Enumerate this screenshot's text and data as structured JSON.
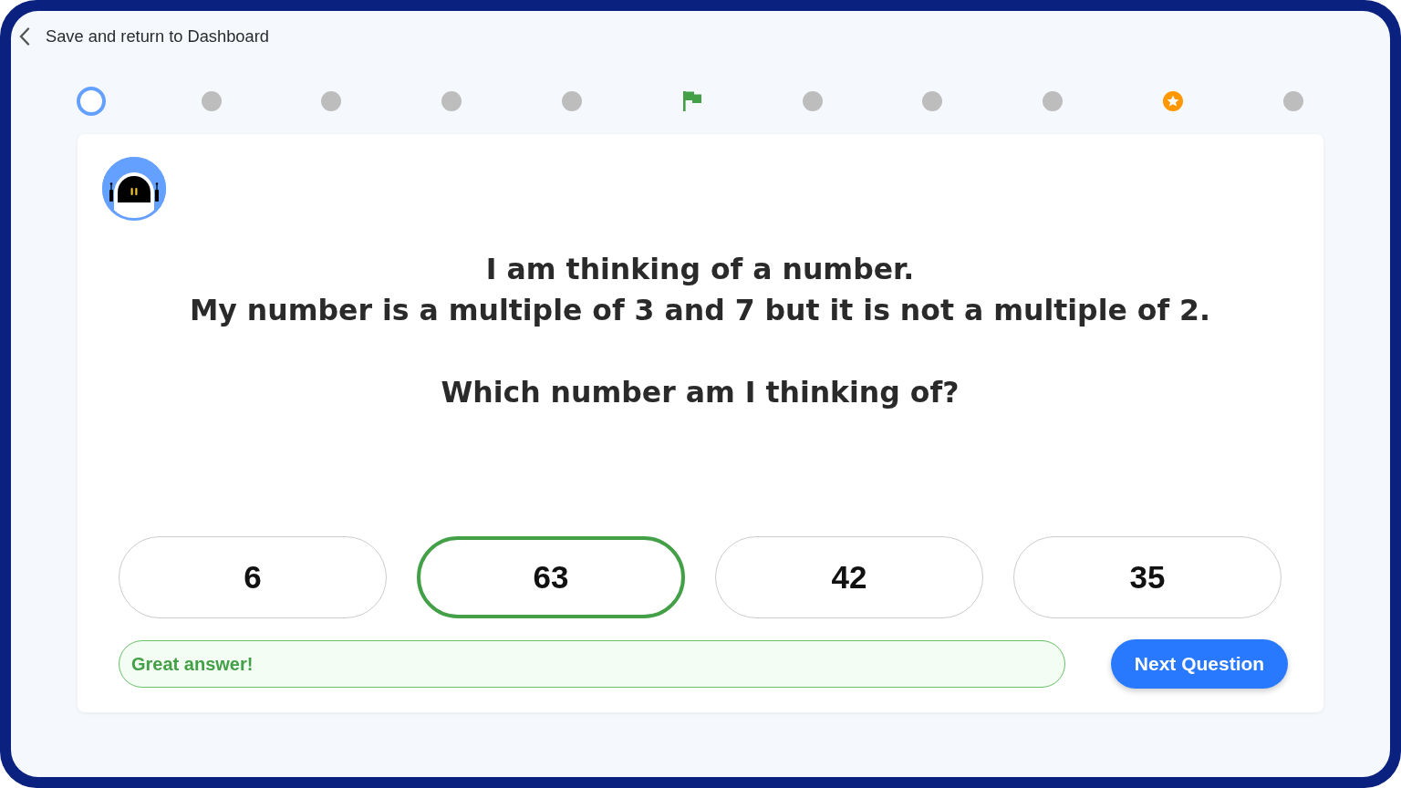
{
  "header": {
    "back_link": "Save and return to Dashboard"
  },
  "progress": [
    {
      "kind": "current"
    },
    {
      "kind": "step"
    },
    {
      "kind": "step"
    },
    {
      "kind": "step"
    },
    {
      "kind": "step"
    },
    {
      "kind": "flag"
    },
    {
      "kind": "step"
    },
    {
      "kind": "step"
    },
    {
      "kind": "step"
    },
    {
      "kind": "star"
    },
    {
      "kind": "step"
    }
  ],
  "question": {
    "paragraphs": [
      [
        "I am thinking of a number.",
        "My number is a multiple of 3 and 7 but it is not a multiple of 2."
      ],
      [
        "Which number am I thinking of?"
      ]
    ]
  },
  "answers": [
    {
      "label": "6",
      "selected": false
    },
    {
      "label": "63",
      "selected": true
    },
    {
      "label": "42",
      "selected": false
    },
    {
      "label": "35",
      "selected": false
    }
  ],
  "feedback": {
    "text": "Great answer!",
    "correct": true
  },
  "next_button": {
    "label": "Next Question"
  }
}
